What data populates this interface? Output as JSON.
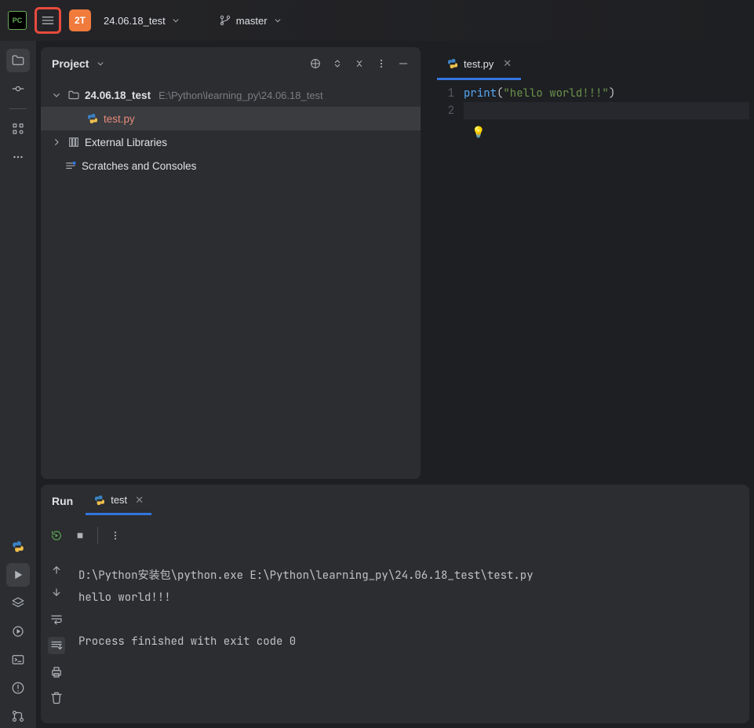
{
  "topbar": {
    "project_chip": "2T",
    "project_name": "24.06.18_test",
    "branch": "master"
  },
  "project_panel": {
    "title": "Project",
    "root_name": "24.06.18_test",
    "root_path": "E:\\Python\\learning_py\\24.06.18_test",
    "file": "test.py",
    "ext_lib": "External Libraries",
    "scratches": "Scratches and Consoles"
  },
  "editor": {
    "tab_name": "test.py",
    "lines": {
      "1": "1",
      "2": "2"
    },
    "code_fn": "print",
    "code_str": "\"hello world!!!\""
  },
  "run": {
    "title": "Run",
    "tab": "test",
    "output_cmd": "D:\\Python安装包\\python.exe E:\\Python\\learning_py\\24.06.18_test\\test.py",
    "output_line": "hello world!!!",
    "output_exit": "Process finished with exit code 0"
  }
}
